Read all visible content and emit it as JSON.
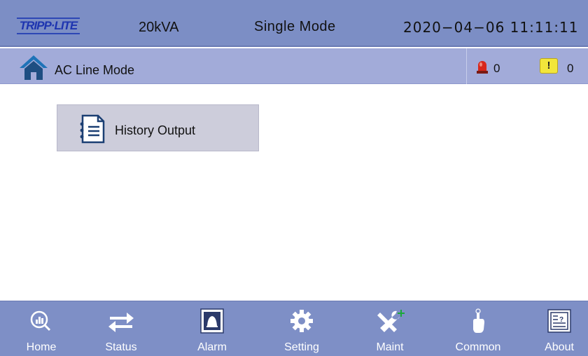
{
  "header": {
    "brand": "TRIPP·LITE",
    "capacity": "20kVA",
    "mode": "Single  Mode",
    "datetime": "2020−04−06  11:11:11"
  },
  "status": {
    "line_mode": "AC Line Mode",
    "alarm_count": "0",
    "warning_symbol": "!",
    "warning_count": "0"
  },
  "main": {
    "history_button": "History  Output"
  },
  "nav": {
    "items": [
      {
        "label": "Home",
        "icon": "home-magnifier-icon"
      },
      {
        "label": "Status",
        "icon": "transfer-arrows-icon"
      },
      {
        "label": "Alarm",
        "icon": "bell-icon"
      },
      {
        "label": "Setting",
        "icon": "gear-icon"
      },
      {
        "label": "Maint",
        "icon": "tools-icon"
      },
      {
        "label": "Common",
        "icon": "pointer-hand-icon"
      },
      {
        "label": "About",
        "icon": "document-info-icon"
      }
    ]
  },
  "colors": {
    "topbar": "#7c8ec5",
    "statusbar": "#a2abd9",
    "button_bg": "#cdcddb",
    "nav_bg": "#7e8fc6"
  }
}
